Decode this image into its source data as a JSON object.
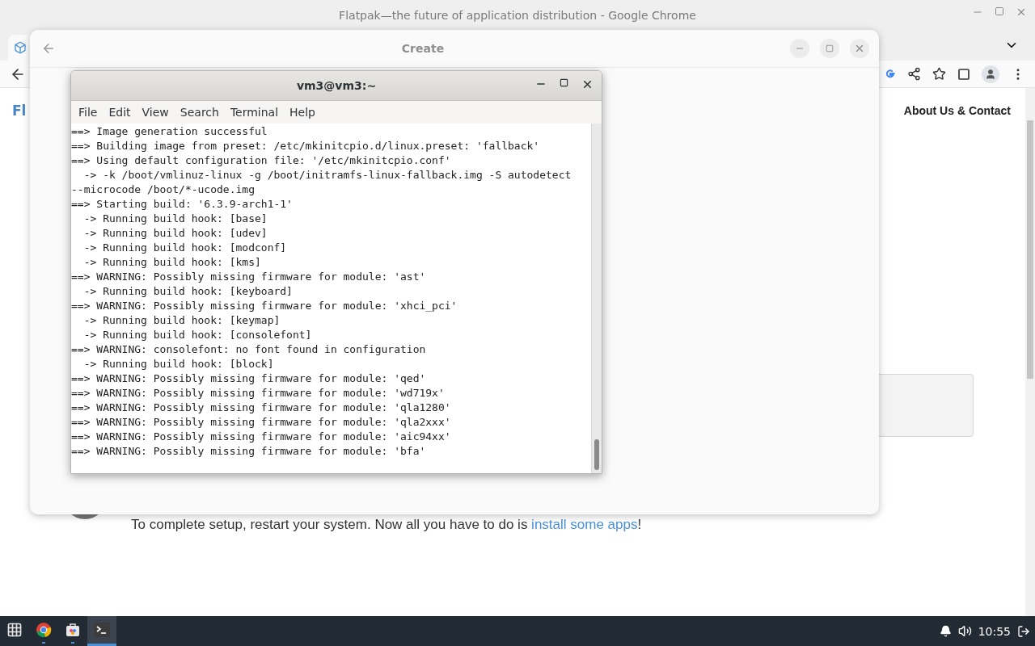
{
  "browser": {
    "title": "Flatpak—the future of application distribution - Google Chrome",
    "page": {
      "logo_text": "Fl",
      "nav_link": "About Us & Contact",
      "step": {
        "before": "To complete setup, restart your system. Now all you have to do is ",
        "link": "install some apps",
        "after": "!"
      }
    }
  },
  "dialog": {
    "title": "Create"
  },
  "terminal": {
    "title": "vm3@vm3:~",
    "menu": [
      "File",
      "Edit",
      "View",
      "Search",
      "Terminal",
      "Help"
    ],
    "lines": [
      "==> Image generation successful",
      "==> Building image from preset: /etc/mkinitcpio.d/linux.preset: 'fallback'",
      "==> Using default configuration file: '/etc/mkinitcpio.conf'",
      "  -> -k /boot/vmlinuz-linux -g /boot/initramfs-linux-fallback.img -S autodetect",
      "--microcode /boot/*-ucode.img",
      "==> Starting build: '6.3.9-arch1-1'",
      "  -> Running build hook: [base]",
      "  -> Running build hook: [udev]",
      "  -> Running build hook: [modconf]",
      "  -> Running build hook: [kms]",
      "==> WARNING: Possibly missing firmware for module: 'ast'",
      "  -> Running build hook: [keyboard]",
      "==> WARNING: Possibly missing firmware for module: 'xhci_pci'",
      "  -> Running build hook: [keymap]",
      "  -> Running build hook: [consolefont]",
      "==> WARNING: consolefont: no font found in configuration",
      "  -> Running build hook: [block]",
      "==> WARNING: Possibly missing firmware for module: 'qed'",
      "==> WARNING: Possibly missing firmware for module: 'wd719x'",
      "==> WARNING: Possibly missing firmware for module: 'qla1280'",
      "==> WARNING: Possibly missing firmware for module: 'qla2xxx'",
      "==> WARNING: Possibly missing firmware for module: 'aic94xx'",
      "==> WARNING: Possibly missing firmware for module: 'bfa'"
    ]
  },
  "taskbar": {
    "apps": [
      {
        "kind": "launcher",
        "running": false,
        "selected": false
      },
      {
        "kind": "browser",
        "running": true,
        "selected": false
      },
      {
        "kind": "store",
        "running": true,
        "selected": false
      },
      {
        "kind": "terminal",
        "running": true,
        "selected": true
      }
    ],
    "clock": "10:55"
  }
}
